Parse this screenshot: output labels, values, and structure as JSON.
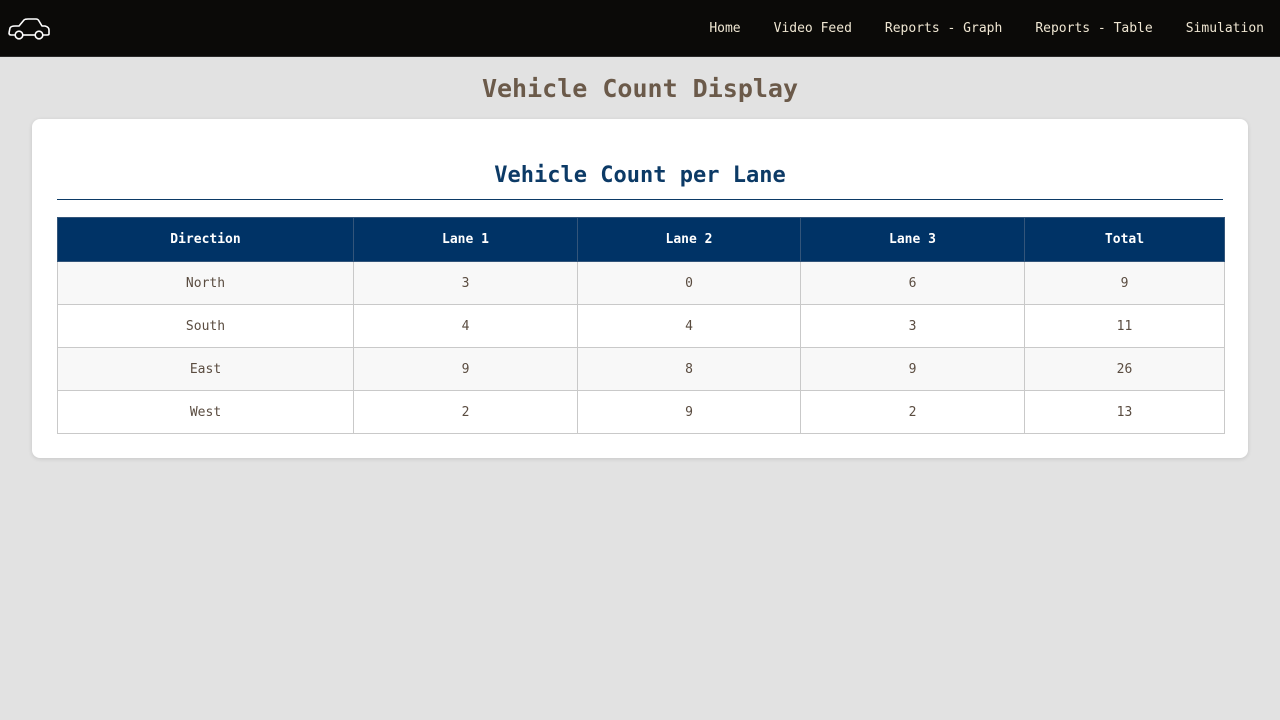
{
  "nav": {
    "logo_icon": "car-icon",
    "links": [
      {
        "label": "Home"
      },
      {
        "label": "Video Feed"
      },
      {
        "label": "Reports - Graph"
      },
      {
        "label": "Reports - Table"
      },
      {
        "label": "Simulation"
      }
    ]
  },
  "page": {
    "title": "Vehicle Count Display"
  },
  "card": {
    "title": "Vehicle Count per Lane",
    "table": {
      "headers": [
        "Direction",
        "Lane 1",
        "Lane 2",
        "Lane 3",
        "Total"
      ],
      "rows": [
        [
          "North",
          "3",
          "0",
          "6",
          "9"
        ],
        [
          "South",
          "4",
          "4",
          "3",
          "11"
        ],
        [
          "East",
          "9",
          "8",
          "9",
          "26"
        ],
        [
          "West",
          "2",
          "9",
          "2",
          "13"
        ]
      ]
    }
  },
  "colors": {
    "navbar_bg": "#0b0a08",
    "page_bg": "#e2e2e2",
    "header_bg": "#003366",
    "accent": "#0c3a66",
    "title_text": "#6b5a4a"
  }
}
